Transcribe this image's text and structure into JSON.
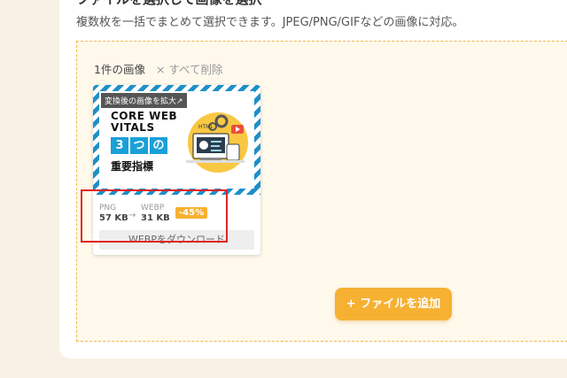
{
  "page": {
    "heading": "ファイルを選択して画像を選択",
    "description": "複数枚を一括でまとめて選択できます。JPEG/PNG/GIFなどの画像に対応。"
  },
  "list": {
    "count_label": "1件の画像",
    "clear_all_label": "× すべて削除"
  },
  "file_item": {
    "thumb_badge": "変換後の画像を拡大↗",
    "thumb_text": {
      "line1": "CORE WEB",
      "line2": "VITALS",
      "mitsu": [
        "3",
        "つ",
        "の"
      ],
      "line3": "重要指標"
    },
    "from_format": "PNG",
    "from_size": "57 KB",
    "to_format": "WEBP",
    "to_size": "31 KB",
    "reduction": "-45%",
    "download_label": "WEBPをダウンロード"
  },
  "actions": {
    "add_file_label": "+ ファイルを追加"
  },
  "colors": {
    "accent": "#f6b132",
    "stripe": "#1f8fc8",
    "highlight": "#e02525"
  }
}
